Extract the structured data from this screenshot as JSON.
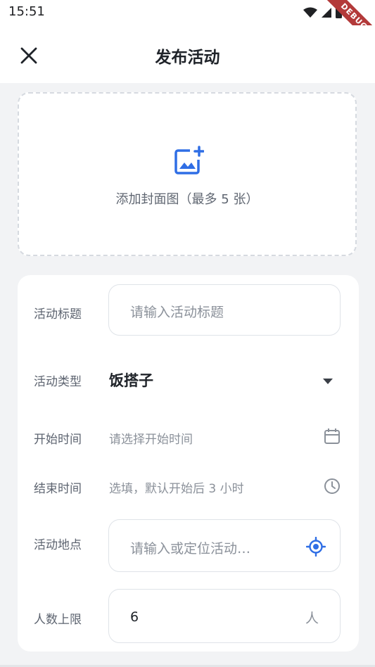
{
  "status_bar": {
    "time": "15:51",
    "debug_label": "DEBUG"
  },
  "header": {
    "title": "发布活动",
    "close_icon": "close-icon"
  },
  "cover": {
    "icon": "add-photo-icon",
    "label": "添加封面图（最多 5 张）"
  },
  "form": {
    "title": {
      "label": "活动标题",
      "placeholder": "请输入活动标题"
    },
    "type": {
      "label": "活动类型",
      "value": "饭搭子",
      "icon": "dropdown-arrow-icon"
    },
    "start_time": {
      "label": "开始时间",
      "placeholder": "请选择开始时间",
      "icon": "calendar-icon"
    },
    "end_time": {
      "label": "结束时间",
      "placeholder": "选填，默认开始后 3 小时",
      "icon": "clock-icon"
    },
    "location": {
      "label": "活动地点",
      "placeholder": "请输入或定位活动…",
      "icon": "locate-icon"
    },
    "max_people": {
      "label": "人数上限",
      "value": "6",
      "unit": "人"
    }
  },
  "colors": {
    "accent": "#2f6ee5",
    "background": "#f2f3f5",
    "card": "#ffffff",
    "placeholder": "#8b919a",
    "debug_ribbon": "#b33a3a"
  }
}
